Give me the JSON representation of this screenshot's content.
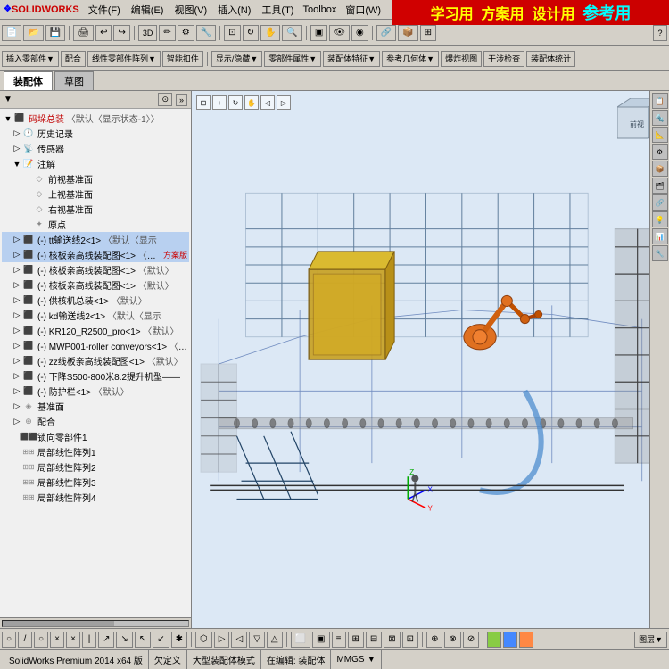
{
  "app": {
    "title": "SolidWorks",
    "version": "SolidWorks Premium 2014 x64 版"
  },
  "menu": {
    "items": [
      "文件(F)",
      "编辑(E)",
      "视图(V)",
      "插入(N)",
      "工具(T)",
      "Toolbox",
      "窗口(W)"
    ]
  },
  "promo": {
    "text": "学习用  方案用  设计用  参考用"
  },
  "tabs": {
    "items": [
      "装配体",
      "草图"
    ],
    "active": 0
  },
  "tree": {
    "items": [
      {
        "id": "root",
        "label": "码垛总装",
        "extra": "〈默认〈显示状态-1〉〉",
        "indent": 0,
        "type": "root",
        "expand": true
      },
      {
        "id": "history",
        "label": "历史记录",
        "indent": 1,
        "type": "history"
      },
      {
        "id": "sensor",
        "label": "传感器",
        "indent": 1,
        "type": "sensor"
      },
      {
        "id": "annotation",
        "label": "注解",
        "indent": 1,
        "type": "annotation",
        "expand": true
      },
      {
        "id": "front",
        "label": "前视基准面",
        "indent": 2,
        "type": "plane"
      },
      {
        "id": "top",
        "label": "上视基准面",
        "indent": 2,
        "type": "plane"
      },
      {
        "id": "right",
        "label": "右视基准面",
        "indent": 2,
        "type": "plane"
      },
      {
        "id": "origin",
        "label": "原点",
        "indent": 2,
        "type": "point"
      },
      {
        "id": "tt1",
        "label": "(-) tt输送线2<1>",
        "extra": "〈默认〈显示",
        "indent": 1,
        "type": "assembly",
        "color": "red"
      },
      {
        "id": "tt2",
        "label": "(-) 核板亲高线装配图<1>",
        "extra": "〈默认〉",
        "indent": 1,
        "type": "assembly",
        "color": "red",
        "extra2": "方案版"
      },
      {
        "id": "tt3",
        "label": "(-) 核板亲高线装配图<1>",
        "extra": "〈默认〉",
        "indent": 1,
        "type": "assembly"
      },
      {
        "id": "tt4",
        "label": "(-) 核板亲高线装配图<1>",
        "extra": "〈默认〉",
        "indent": 1,
        "type": "assembly"
      },
      {
        "id": "tt5",
        "label": "(-) 供核机总装<1>",
        "extra": "〈默认〉",
        "indent": 1,
        "type": "assembly"
      },
      {
        "id": "tt6",
        "label": "(-) kd输送线2<1>",
        "extra": "〈默认〈显示",
        "indent": 1,
        "type": "assembly",
        "color": "red"
      },
      {
        "id": "tt7",
        "label": "(-) KR120_R2500_pro<1>",
        "extra": "〈默认〉",
        "indent": 1,
        "type": "assembly"
      },
      {
        "id": "tt8",
        "label": "(-) MWP001-roller conveyors<1>",
        "extra": "〈默认..",
        "indent": 1,
        "type": "assembly"
      },
      {
        "id": "tt9",
        "label": "(-) zz线板亲高线装配图<1>",
        "extra": "〈默认〉",
        "indent": 1,
        "type": "assembly"
      },
      {
        "id": "tt10",
        "label": "(-) 下降S500-800米8.2提升机型——",
        "extra": "",
        "indent": 1,
        "type": "assembly"
      },
      {
        "id": "tt11",
        "label": "(-) 防护栏<1>",
        "extra": "〈默认〉",
        "indent": 1,
        "type": "assembly"
      },
      {
        "id": "datum",
        "label": "基准面",
        "indent": 1,
        "type": "datum"
      },
      {
        "id": "mate",
        "label": "配合",
        "indent": 1,
        "type": "mate"
      },
      {
        "id": "radial1",
        "label": "锁向零部件1",
        "indent": 1,
        "type": "part",
        "color": "red"
      },
      {
        "id": "pattern1",
        "label": "局部线性阵列1",
        "indent": 1,
        "type": "pattern"
      },
      {
        "id": "pattern2",
        "label": "局部线性阵列2",
        "indent": 1,
        "type": "pattern"
      },
      {
        "id": "pattern3",
        "label": "局部线性阵列3",
        "indent": 1,
        "type": "pattern"
      },
      {
        "id": "pattern4",
        "label": "局部线性阵列4",
        "indent": 1,
        "type": "pattern"
      }
    ]
  },
  "viewport": {
    "bg_color": "#dce8f5"
  },
  "toolbar_bottom": {
    "buttons": [
      "○",
      "/",
      "○",
      "×",
      "×",
      "|",
      "↗",
      "↘",
      "↖",
      "↙",
      "✱",
      "⬡",
      "▷",
      "◁",
      "▽",
      "△",
      "⬜",
      "▣",
      "≡",
      "⊞",
      "⊟",
      "⊠",
      "⊡",
      "⊕",
      "⊗",
      "⊘"
    ]
  },
  "status": {
    "left": "SolidWorks Premium 2014 x64 版",
    "items": [
      "欠定义",
      "大型装配体模式",
      "在编辑: 装配体",
      "MMGS ▼"
    ]
  },
  "right_panel": {
    "icons": [
      "📋",
      "🔧",
      "📐",
      "⚙",
      "🔩",
      "📦",
      "🗂",
      "🔗",
      "💡",
      "📊"
    ]
  }
}
